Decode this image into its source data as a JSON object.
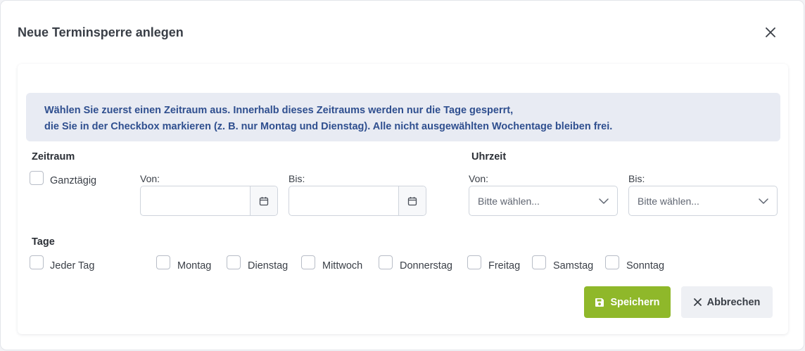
{
  "dialog": {
    "title": "Neue Terminsperre anlegen",
    "info_line1": "Wählen Sie zuerst einen Zeitraum aus. Innerhalb dieses Zeitraums werden nur die Tage gesperrt,",
    "info_line2": "die Sie in der Checkbox markieren (z. B. nur Montag und Dienstag). Alle nicht ausgewählten Wochentage bleiben frei."
  },
  "zeitraum": {
    "label": "Zeitraum",
    "ganztaegig_label": "Ganztägig",
    "ganztaegig_checked": false,
    "von_label": "Von:",
    "von_value": "",
    "bis_label": "Bis:",
    "bis_value": ""
  },
  "uhrzeit": {
    "label": "Uhrzeit",
    "von_label": "Von:",
    "von_placeholder": "Bitte wählen...",
    "bis_label": "Bis:",
    "bis_placeholder": "Bitte wählen..."
  },
  "tage": {
    "label": "Tage",
    "jeder_tag": "Jeder Tag",
    "days": [
      "Montag",
      "Dienstag",
      "Mittwoch",
      "Donnerstag",
      "Freitag",
      "Samstag",
      "Sonntag"
    ]
  },
  "actions": {
    "save_label": "Speichern",
    "cancel_label": "Abbrechen"
  },
  "colors": {
    "save_button": "#8fb82a",
    "info_text": "#2f4f8f",
    "info_background": "#e8ebf3"
  },
  "icons": {
    "close": "close-icon",
    "calendar": "calendar-icon",
    "chevron": "chevron-down-icon",
    "save": "floppy-disk-icon",
    "cancel": "x-icon"
  }
}
